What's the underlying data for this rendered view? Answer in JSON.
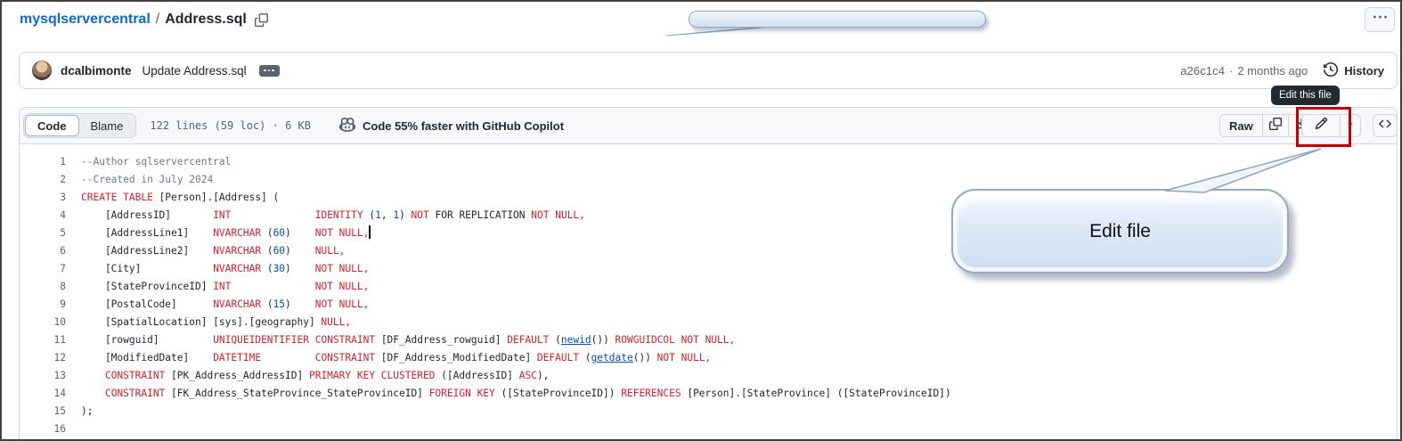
{
  "breadcrumb": {
    "repo": "mysqlservercentral",
    "separator": "/",
    "file": "Address.sql"
  },
  "commit_bar": {
    "author": "dcalbimonte",
    "message": "Update Address.sql",
    "sha": "a26c1c4",
    "separator": "·",
    "time_ago": "2 months ago",
    "history_label": "History"
  },
  "edit_tooltip": {
    "label": "Edit this file"
  },
  "file_toolbar": {
    "tabs": [
      {
        "label": "Code",
        "active": true
      },
      {
        "label": "Blame",
        "active": false
      }
    ],
    "meta": "122 lines (59 loc) · 6 KB",
    "copilot_text": "Code 55% faster with GitHub Copilot",
    "raw_label": "Raw"
  },
  "annotations": {
    "edit_file_label": "Edit file"
  },
  "icons": {
    "breadcrumb_copy": "copy-icon",
    "more_menu": "kebab-horizontal-icon",
    "commit_expander": "ellipsis-icon",
    "history": "history-clock-icon",
    "copilot": "copilot-icon",
    "copy": "copy-icon",
    "download": "download-icon",
    "edit": "pencil-icon",
    "edit_dropdown": "triangle-down-icon",
    "symbols": "code-icon"
  },
  "colors": {
    "link_blue": "#0969da",
    "keyword_red": "#cf222e",
    "number_blue": "#0550ae",
    "comment_gray": "#6e7781",
    "code_plain": "#1f2328",
    "tooltip_bg": "#24292f",
    "highlight_red": "#c40000",
    "callout_fill": "#dce8f8",
    "callout_border": "#93a9c4",
    "panel_header_bg": "#f6f8fa",
    "border_gray": "#d0d7de"
  },
  "code": {
    "lines": [
      {
        "num": 1,
        "segs": [
          [
            "c",
            "--Author sqlservercentral"
          ]
        ]
      },
      {
        "num": 2,
        "segs": [
          [
            "c",
            "--Created in July 2024"
          ]
        ]
      },
      {
        "num": 3,
        "segs": [
          [
            "k",
            "CREATE TABLE"
          ],
          [
            "p",
            " [Person].[Address] ("
          ]
        ]
      },
      {
        "num": 4,
        "segs": [
          [
            "p",
            "    [AddressID]       "
          ],
          [
            "k",
            "INT"
          ],
          [
            "p",
            "              "
          ],
          [
            "k",
            "IDENTITY"
          ],
          [
            "p",
            " ("
          ],
          [
            "n",
            "1"
          ],
          [
            "p",
            ", "
          ],
          [
            "n",
            "1"
          ],
          [
            "p",
            ") "
          ],
          [
            "k",
            "NOT"
          ],
          [
            "p",
            " FOR REPLICATION "
          ],
          [
            "k",
            "NOT NULL,"
          ]
        ]
      },
      {
        "num": 5,
        "segs": [
          [
            "p",
            "    [AddressLine1]    "
          ],
          [
            "k",
            "NVARCHAR"
          ],
          [
            "p",
            " ("
          ],
          [
            "n",
            "60"
          ],
          [
            "p",
            ")    "
          ],
          [
            "k",
            "NOT NULL,"
          ]
        ],
        "cursor": true
      },
      {
        "num": 6,
        "segs": [
          [
            "p",
            "    [AddressLine2]    "
          ],
          [
            "k",
            "NVARCHAR"
          ],
          [
            "p",
            " ("
          ],
          [
            "n",
            "60"
          ],
          [
            "p",
            ")    "
          ],
          [
            "k",
            "NULL,"
          ]
        ]
      },
      {
        "num": 7,
        "segs": [
          [
            "p",
            "    [City]            "
          ],
          [
            "k",
            "NVARCHAR"
          ],
          [
            "p",
            " ("
          ],
          [
            "n",
            "30"
          ],
          [
            "p",
            ")    "
          ],
          [
            "k",
            "NOT NULL,"
          ]
        ]
      },
      {
        "num": 8,
        "segs": [
          [
            "p",
            "    [StateProvinceID] "
          ],
          [
            "k",
            "INT"
          ],
          [
            "p",
            "              "
          ],
          [
            "k",
            "NOT NULL,"
          ]
        ]
      },
      {
        "num": 9,
        "segs": [
          [
            "p",
            "    [PostalCode]      "
          ],
          [
            "k",
            "NVARCHAR"
          ],
          [
            "p",
            " ("
          ],
          [
            "n",
            "15"
          ],
          [
            "p",
            ")    "
          ],
          [
            "k",
            "NOT NULL,"
          ]
        ]
      },
      {
        "num": 10,
        "segs": [
          [
            "p",
            "    [SpatialLocation] [sys].[geography] "
          ],
          [
            "k",
            "NULL,"
          ]
        ]
      },
      {
        "num": 11,
        "segs": [
          [
            "p",
            "    [rowguid]         "
          ],
          [
            "k",
            "UNIQUEIDENTIFIER"
          ],
          [
            "p",
            " "
          ],
          [
            "k",
            "CONSTRAINT"
          ],
          [
            "p",
            " [DF_Address_rowguid] "
          ],
          [
            "k",
            "DEFAULT"
          ],
          [
            "p",
            " ("
          ],
          [
            "f",
            "newid"
          ],
          [
            "p",
            "()) "
          ],
          [
            "k",
            "ROWGUIDCOL NOT NULL,"
          ]
        ]
      },
      {
        "num": 12,
        "segs": [
          [
            "p",
            "    [ModifiedDate]    "
          ],
          [
            "k",
            "DATETIME"
          ],
          [
            "p",
            "         "
          ],
          [
            "k",
            "CONSTRAINT"
          ],
          [
            "p",
            " [DF_Address_ModifiedDate] "
          ],
          [
            "k",
            "DEFAULT"
          ],
          [
            "p",
            " ("
          ],
          [
            "f",
            "getdate"
          ],
          [
            "p",
            "()) "
          ],
          [
            "k",
            "NOT NULL,"
          ]
        ]
      },
      {
        "num": 13,
        "segs": [
          [
            "p",
            "    "
          ],
          [
            "k",
            "CONSTRAINT"
          ],
          [
            "p",
            " [PK_Address_AddressID] "
          ],
          [
            "k",
            "PRIMARY KEY CLUSTERED"
          ],
          [
            "p",
            " ([AddressID] "
          ],
          [
            "k",
            "ASC"
          ],
          [
            "p",
            "),"
          ]
        ]
      },
      {
        "num": 14,
        "segs": [
          [
            "p",
            "    "
          ],
          [
            "k",
            "CONSTRAINT"
          ],
          [
            "p",
            " [FK_Address_StateProvince_StateProvinceID] "
          ],
          [
            "k",
            "FOREIGN KEY"
          ],
          [
            "p",
            " ([StateProvinceID]) "
          ],
          [
            "k",
            "REFERENCES"
          ],
          [
            "p",
            " [Person].[StateProvince] ([StateProvinceID])"
          ]
        ]
      },
      {
        "num": 15,
        "segs": [
          [
            "p",
            ");"
          ]
        ]
      },
      {
        "num": 16,
        "segs": []
      }
    ]
  }
}
